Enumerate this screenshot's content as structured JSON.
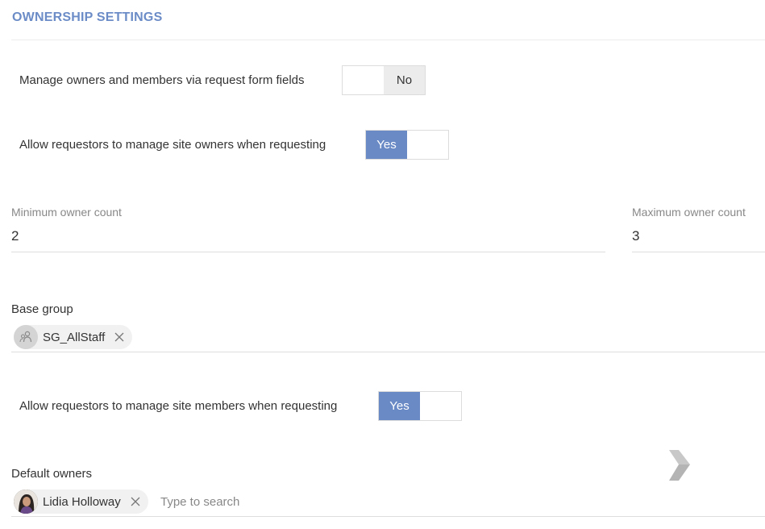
{
  "section": {
    "title": "OWNERSHIP SETTINGS"
  },
  "toggles": {
    "manage_via_form": {
      "label": "Manage owners and members via request form fields",
      "value": "No",
      "on": false
    },
    "manage_owners": {
      "label": "Allow requestors to manage site owners when requesting",
      "value": "Yes",
      "on": true
    },
    "manage_members": {
      "label": "Allow requestors to manage site members when requesting",
      "value": "Yes",
      "on": true
    }
  },
  "owner_count": {
    "min_label": "Minimum owner count",
    "min_value": "2",
    "max_label": "Maximum owner count",
    "max_value": "3"
  },
  "base_group": {
    "label": "Base group",
    "chips": [
      {
        "name": "SG_AllStaff",
        "icon": "group-icon"
      }
    ]
  },
  "default_owners": {
    "label": "Default owners",
    "chips": [
      {
        "name": "Lidia Holloway",
        "icon": "user-avatar"
      }
    ],
    "search_placeholder": "Type to search"
  },
  "icons": {
    "chip_remove": "close-icon",
    "logo": "chevron-logo-icon"
  },
  "colors": {
    "accent": "#6a8ac6",
    "title": "#6b8cc7",
    "toggle_off": "#ececec"
  }
}
